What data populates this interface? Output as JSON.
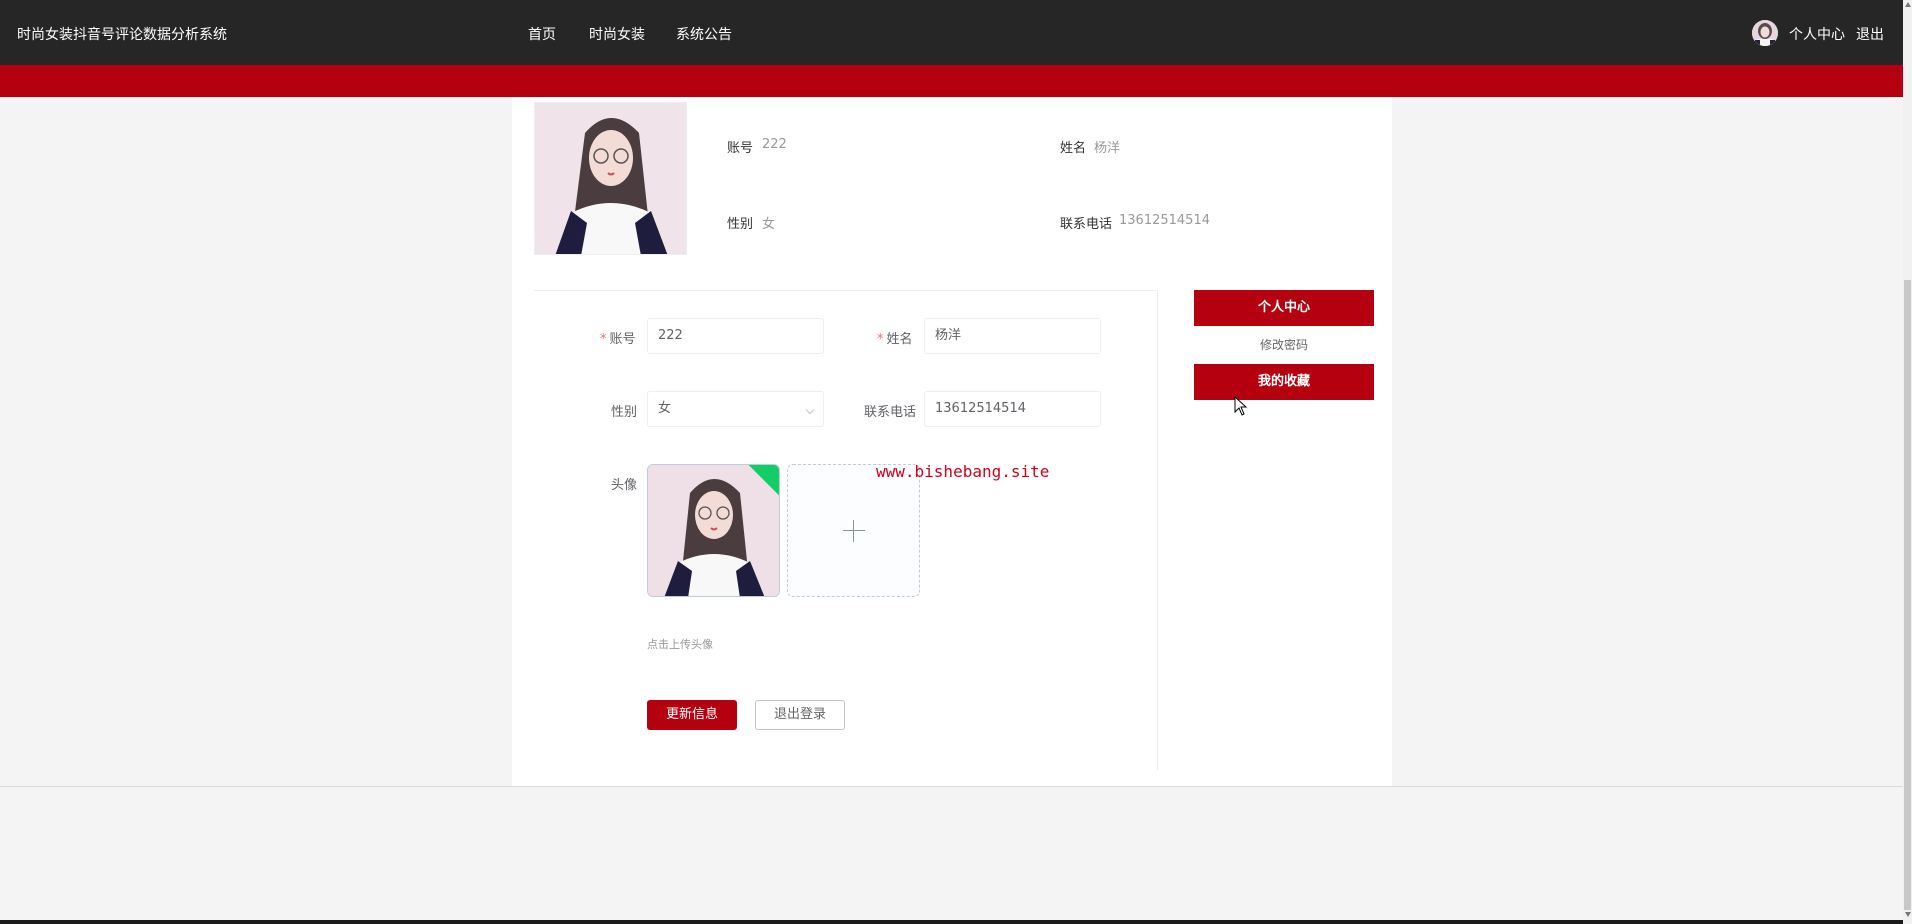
{
  "header": {
    "brand": "时尚女装抖音号评论数据分析系统",
    "nav": [
      "首页",
      "时尚女装",
      "系统公告"
    ],
    "user_center": "个人中心",
    "logout": "退出"
  },
  "profile_summary": {
    "account_label": "账号",
    "account_value": "222",
    "name_label": "姓名",
    "name_value": "杨洋",
    "gender_label": "性别",
    "gender_value": "女",
    "phone_label": "联系电话",
    "phone_value": "13612514514"
  },
  "form": {
    "account_label": "账号",
    "account_value": "222",
    "name_label": "姓名",
    "name_value": "杨洋",
    "gender_label": "性别",
    "gender_value": "女",
    "phone_label": "联系电话",
    "phone_value": "13612514514",
    "avatar_label": "头像",
    "upload_tip": "点击上传头像",
    "update_button": "更新信息",
    "logout_button": "退出登录"
  },
  "sidebar": {
    "items": [
      "个人中心",
      "修改密码",
      "我的收藏"
    ]
  },
  "watermark": "www.bishebang.site",
  "colors": {
    "accent": "#b5000f",
    "topbar": "#262626",
    "success": "#13ce66"
  },
  "icons": {
    "avatar": "avatar-icon",
    "upload_add": "plus-icon",
    "upload_success": "check-icon",
    "select_arrow": "chevron-down-icon",
    "cursor": "mouse-cursor-icon"
  }
}
